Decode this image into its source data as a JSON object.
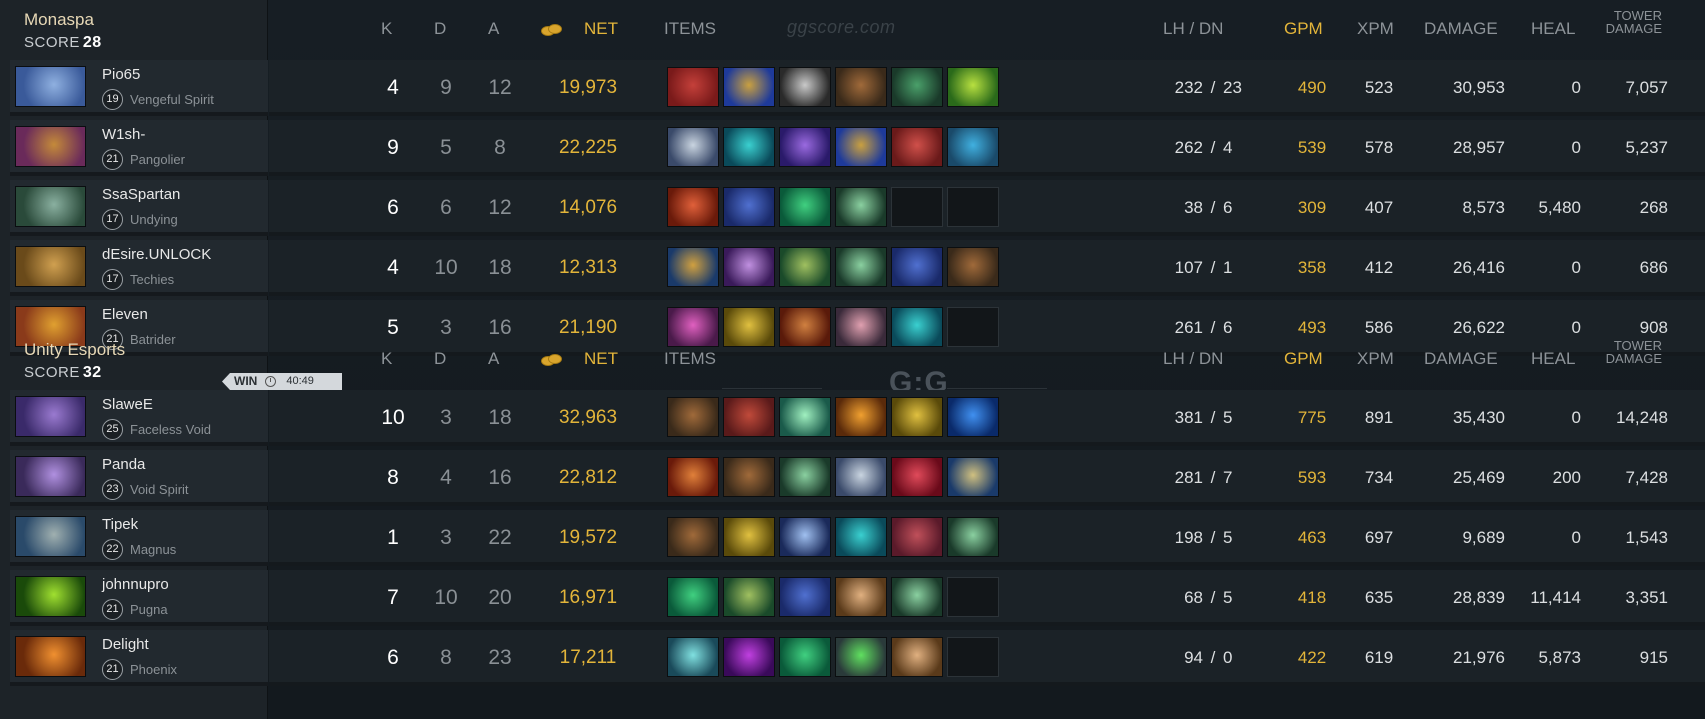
{
  "site": {
    "watermark": "ggscore.com",
    "logo": "G:G",
    "logo_sub": "ggscore.com"
  },
  "header": {
    "k": "K",
    "d": "D",
    "a": "A",
    "net": "NET",
    "items": "ITEMS",
    "lh_dn": "LH  /  DN",
    "gpm": "GPM",
    "xpm": "XPM",
    "damage": "DAMAGE",
    "heal": "HEAL",
    "tower_1": "TOWER",
    "tower_2": "DAMAGE"
  },
  "result": {
    "label": "WIN",
    "duration": "40:49"
  },
  "colors": {
    "gold": "#e3b53a",
    "team_name": "#e7d8b6",
    "background": "#13191e"
  },
  "teams": [
    {
      "name": "Monaspa",
      "score_label": "SCORE",
      "score": "28",
      "players": [
        {
          "name": "Pio65",
          "level": "19",
          "hero": "Vengeful Spirit",
          "k": "4",
          "d": "9",
          "a": "12",
          "net": "19,973",
          "lh": "232",
          "dn": "23",
          "gpm": "490",
          "xpm": "523",
          "damage": "30,953",
          "heal": "0",
          "tower": "7,057",
          "portrait": [
            "#3a5a9a",
            "#8fb0e0"
          ],
          "items": [
            [
              "#7a1a1a",
              "#c4403a"
            ],
            [
              "#1e3a9a",
              "#c9a040"
            ],
            [
              "#2a2a2a",
              "#c9c9c9"
            ],
            [
              "#3a2a1a",
              "#a06a3a"
            ],
            [
              "#1a3a2a",
              "#4aa06a"
            ],
            [
              "#2a6a1a",
              "#b8e040"
            ]
          ]
        },
        {
          "name": "W1sh-",
          "level": "21",
          "hero": "Pangolier",
          "k": "9",
          "d": "5",
          "a": "8",
          "net": "22,225",
          "lh": "262",
          "dn": "4",
          "gpm": "539",
          "xpm": "578",
          "damage": "28,957",
          "heal": "0",
          "tower": "5,237",
          "portrait": [
            "#6a2a5a",
            "#c48a3a"
          ],
          "items": [
            [
              "#3a4a6a",
              "#c9d4e0"
            ],
            [
              "#0a4a5a",
              "#3ad0d0"
            ],
            [
              "#2a1a6a",
              "#9a6ae0"
            ],
            [
              "#1e3a9a",
              "#c9a040"
            ],
            [
              "#6a1a1a",
              "#d0504a"
            ],
            [
              "#1a4a6a",
              "#40b0e0"
            ]
          ]
        },
        {
          "name": "SsaSpartan",
          "level": "17",
          "hero": "Undying",
          "k": "6",
          "d": "6",
          "a": "12",
          "net": "14,076",
          "lh": "38",
          "dn": "6",
          "gpm": "309",
          "xpm": "407",
          "damage": "8,573",
          "heal": "5,480",
          "tower": "268",
          "portrait": [
            "#2a4a3a",
            "#8ab0a0"
          ],
          "items": [
            [
              "#6a1a0a",
              "#e0603a"
            ],
            [
              "#1a2a6a",
              "#5070d0"
            ],
            [
              "#0a5a3a",
              "#40d080"
            ],
            [
              "#1a3a2a",
              "#8ad0a0"
            ],
            null,
            null
          ]
        },
        {
          "name": "dEsire.UNLOCK",
          "level": "17",
          "hero": "Techies",
          "k": "4",
          "d": "10",
          "a": "18",
          "net": "12,313",
          "lh": "107",
          "dn": "1",
          "gpm": "358",
          "xpm": "412",
          "damage": "26,416",
          "heal": "0",
          "tower": "686",
          "portrait": [
            "#6a4a1a",
            "#d0a050"
          ],
          "items": [
            [
              "#1a3a6a",
              "#d0a040"
            ],
            [
              "#3a1a5a",
              "#c090e0"
            ],
            [
              "#1a4a2a",
              "#a0c060"
            ],
            [
              "#1a3a2a",
              "#8ad0a0"
            ],
            [
              "#1a2a6a",
              "#5070d0"
            ],
            [
              "#3a2a1a",
              "#a06a3a"
            ]
          ]
        },
        {
          "name": "Eleven",
          "level": "21",
          "hero": "Batrider",
          "k": "5",
          "d": "3",
          "a": "16",
          "net": "21,190",
          "lh": "261",
          "dn": "6",
          "gpm": "493",
          "xpm": "586",
          "damage": "26,622",
          "heal": "0",
          "tower": "908",
          "portrait": [
            "#8a3a1a",
            "#e0a030"
          ],
          "items": [
            [
              "#4a1a4a",
              "#e060c0"
            ],
            [
              "#5a4a0a",
              "#e0c040"
            ],
            [
              "#5a1a0a",
              "#d08040"
            ],
            [
              "#3a2a3a",
              "#e0a0b0"
            ],
            [
              "#0a4a5a",
              "#3ad0d0"
            ],
            null
          ]
        }
      ]
    },
    {
      "name": "Unity Esports",
      "score_label": "SCORE",
      "score": "32",
      "players": [
        {
          "name": "SlaweE",
          "level": "25",
          "hero": "Faceless Void",
          "k": "10",
          "d": "3",
          "a": "18",
          "net": "32,963",
          "lh": "381",
          "dn": "5",
          "gpm": "775",
          "xpm": "891",
          "damage": "35,430",
          "heal": "0",
          "tower": "14,248",
          "portrait": [
            "#3a2a6a",
            "#9a7ad0"
          ],
          "items": [
            [
              "#3a2a1a",
              "#a06a3a"
            ],
            [
              "#5a1a1a",
              "#c04a3a"
            ],
            [
              "#1a5a4a",
              "#a0f0c0"
            ],
            [
              "#5a2a0a",
              "#f0a030"
            ],
            [
              "#5a4a0a",
              "#e0c040"
            ],
            [
              "#0a2a6a",
              "#4090f0"
            ]
          ]
        },
        {
          "name": "Panda",
          "level": "23",
          "hero": "Void Spirit",
          "k": "8",
          "d": "4",
          "a": "16",
          "net": "22,812",
          "lh": "281",
          "dn": "7",
          "gpm": "593",
          "xpm": "734",
          "damage": "25,469",
          "heal": "200",
          "tower": "7,428",
          "portrait": [
            "#3a2a5a",
            "#b090e0"
          ],
          "items": [
            [
              "#6a1a0a",
              "#e0803a"
            ],
            [
              "#3a2a1a",
              "#a06a3a"
            ],
            [
              "#1a3a2a",
              "#8ad0a0"
            ],
            [
              "#3a4a6a",
              "#c9d4e0"
            ],
            [
              "#6a0a1a",
              "#e04a5a"
            ],
            [
              "#1a3a6a",
              "#d0c080"
            ]
          ]
        },
        {
          "name": "Tipek",
          "level": "22",
          "hero": "Magnus",
          "k": "1",
          "d": "3",
          "a": "22",
          "net": "19,572",
          "lh": "198",
          "dn": "5",
          "gpm": "463",
          "xpm": "697",
          "damage": "9,689",
          "heal": "0",
          "tower": "1,543",
          "portrait": [
            "#2a4a6a",
            "#a0b0b0"
          ],
          "items": [
            [
              "#3a2a1a",
              "#a06a3a"
            ],
            [
              "#5a4a0a",
              "#e0c040"
            ],
            [
              "#1a2a5a",
              "#a0c0f0"
            ],
            [
              "#0a4a5a",
              "#3ad0d0"
            ],
            [
              "#5a1a2a",
              "#c0505a"
            ],
            [
              "#1a3a2a",
              "#8ad0a0"
            ]
          ]
        },
        {
          "name": "johnnupro",
          "level": "21",
          "hero": "Pugna",
          "k": "7",
          "d": "10",
          "a": "20",
          "net": "16,971",
          "lh": "68",
          "dn": "5",
          "gpm": "418",
          "xpm": "635",
          "damage": "28,839",
          "heal": "11,414",
          "tower": "3,351",
          "portrait": [
            "#1a4a0a",
            "#a0e030"
          ],
          "items": [
            [
              "#0a5a3a",
              "#40d080"
            ],
            [
              "#1a4a2a",
              "#a0c060"
            ],
            [
              "#1a2a6a",
              "#5070d0"
            ],
            [
              "#5a3a1a",
              "#e0b080"
            ],
            [
              "#1a3a2a",
              "#8ad0a0"
            ],
            null
          ]
        },
        {
          "name": "Delight",
          "level": "21",
          "hero": "Phoenix",
          "k": "6",
          "d": "8",
          "a": "23",
          "net": "17,211",
          "lh": "94",
          "dn": "0",
          "gpm": "422",
          "xpm": "619",
          "damage": "21,976",
          "heal": "5,873",
          "tower": "915",
          "portrait": [
            "#6a2a0a",
            "#f09030"
          ],
          "items": [
            [
              "#1a4a5a",
              "#80e0e0"
            ],
            [
              "#3a0a5a",
              "#c040e0"
            ],
            [
              "#0a5a3a",
              "#40d080"
            ],
            [
              "#2a3a3a",
              "#60e060"
            ],
            [
              "#5a3a1a",
              "#e0b080"
            ],
            null
          ]
        }
      ]
    }
  ]
}
